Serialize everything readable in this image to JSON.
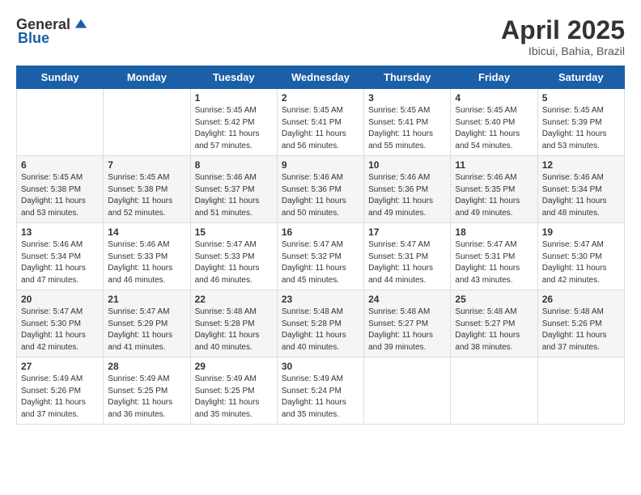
{
  "header": {
    "logo_general": "General",
    "logo_blue": "Blue",
    "month_title": "April 2025",
    "location": "Ibicui, Bahia, Brazil"
  },
  "days_of_week": [
    "Sunday",
    "Monday",
    "Tuesday",
    "Wednesday",
    "Thursday",
    "Friday",
    "Saturday"
  ],
  "weeks": [
    [
      {
        "day": "",
        "sunrise": "",
        "sunset": "",
        "daylight": ""
      },
      {
        "day": "",
        "sunrise": "",
        "sunset": "",
        "daylight": ""
      },
      {
        "day": "1",
        "sunrise": "Sunrise: 5:45 AM",
        "sunset": "Sunset: 5:42 PM",
        "daylight": "Daylight: 11 hours and 57 minutes."
      },
      {
        "day": "2",
        "sunrise": "Sunrise: 5:45 AM",
        "sunset": "Sunset: 5:41 PM",
        "daylight": "Daylight: 11 hours and 56 minutes."
      },
      {
        "day": "3",
        "sunrise": "Sunrise: 5:45 AM",
        "sunset": "Sunset: 5:41 PM",
        "daylight": "Daylight: 11 hours and 55 minutes."
      },
      {
        "day": "4",
        "sunrise": "Sunrise: 5:45 AM",
        "sunset": "Sunset: 5:40 PM",
        "daylight": "Daylight: 11 hours and 54 minutes."
      },
      {
        "day": "5",
        "sunrise": "Sunrise: 5:45 AM",
        "sunset": "Sunset: 5:39 PM",
        "daylight": "Daylight: 11 hours and 53 minutes."
      }
    ],
    [
      {
        "day": "6",
        "sunrise": "Sunrise: 5:45 AM",
        "sunset": "Sunset: 5:38 PM",
        "daylight": "Daylight: 11 hours and 53 minutes."
      },
      {
        "day": "7",
        "sunrise": "Sunrise: 5:45 AM",
        "sunset": "Sunset: 5:38 PM",
        "daylight": "Daylight: 11 hours and 52 minutes."
      },
      {
        "day": "8",
        "sunrise": "Sunrise: 5:46 AM",
        "sunset": "Sunset: 5:37 PM",
        "daylight": "Daylight: 11 hours and 51 minutes."
      },
      {
        "day": "9",
        "sunrise": "Sunrise: 5:46 AM",
        "sunset": "Sunset: 5:36 PM",
        "daylight": "Daylight: 11 hours and 50 minutes."
      },
      {
        "day": "10",
        "sunrise": "Sunrise: 5:46 AM",
        "sunset": "Sunset: 5:36 PM",
        "daylight": "Daylight: 11 hours and 49 minutes."
      },
      {
        "day": "11",
        "sunrise": "Sunrise: 5:46 AM",
        "sunset": "Sunset: 5:35 PM",
        "daylight": "Daylight: 11 hours and 49 minutes."
      },
      {
        "day": "12",
        "sunrise": "Sunrise: 5:46 AM",
        "sunset": "Sunset: 5:34 PM",
        "daylight": "Daylight: 11 hours and 48 minutes."
      }
    ],
    [
      {
        "day": "13",
        "sunrise": "Sunrise: 5:46 AM",
        "sunset": "Sunset: 5:34 PM",
        "daylight": "Daylight: 11 hours and 47 minutes."
      },
      {
        "day": "14",
        "sunrise": "Sunrise: 5:46 AM",
        "sunset": "Sunset: 5:33 PM",
        "daylight": "Daylight: 11 hours and 46 minutes."
      },
      {
        "day": "15",
        "sunrise": "Sunrise: 5:47 AM",
        "sunset": "Sunset: 5:33 PM",
        "daylight": "Daylight: 11 hours and 46 minutes."
      },
      {
        "day": "16",
        "sunrise": "Sunrise: 5:47 AM",
        "sunset": "Sunset: 5:32 PM",
        "daylight": "Daylight: 11 hours and 45 minutes."
      },
      {
        "day": "17",
        "sunrise": "Sunrise: 5:47 AM",
        "sunset": "Sunset: 5:31 PM",
        "daylight": "Daylight: 11 hours and 44 minutes."
      },
      {
        "day": "18",
        "sunrise": "Sunrise: 5:47 AM",
        "sunset": "Sunset: 5:31 PM",
        "daylight": "Daylight: 11 hours and 43 minutes."
      },
      {
        "day": "19",
        "sunrise": "Sunrise: 5:47 AM",
        "sunset": "Sunset: 5:30 PM",
        "daylight": "Daylight: 11 hours and 42 minutes."
      }
    ],
    [
      {
        "day": "20",
        "sunrise": "Sunrise: 5:47 AM",
        "sunset": "Sunset: 5:30 PM",
        "daylight": "Daylight: 11 hours and 42 minutes."
      },
      {
        "day": "21",
        "sunrise": "Sunrise: 5:47 AM",
        "sunset": "Sunset: 5:29 PM",
        "daylight": "Daylight: 11 hours and 41 minutes."
      },
      {
        "day": "22",
        "sunrise": "Sunrise: 5:48 AM",
        "sunset": "Sunset: 5:28 PM",
        "daylight": "Daylight: 11 hours and 40 minutes."
      },
      {
        "day": "23",
        "sunrise": "Sunrise: 5:48 AM",
        "sunset": "Sunset: 5:28 PM",
        "daylight": "Daylight: 11 hours and 40 minutes."
      },
      {
        "day": "24",
        "sunrise": "Sunrise: 5:48 AM",
        "sunset": "Sunset: 5:27 PM",
        "daylight": "Daylight: 11 hours and 39 minutes."
      },
      {
        "day": "25",
        "sunrise": "Sunrise: 5:48 AM",
        "sunset": "Sunset: 5:27 PM",
        "daylight": "Daylight: 11 hours and 38 minutes."
      },
      {
        "day": "26",
        "sunrise": "Sunrise: 5:48 AM",
        "sunset": "Sunset: 5:26 PM",
        "daylight": "Daylight: 11 hours and 37 minutes."
      }
    ],
    [
      {
        "day": "27",
        "sunrise": "Sunrise: 5:49 AM",
        "sunset": "Sunset: 5:26 PM",
        "daylight": "Daylight: 11 hours and 37 minutes."
      },
      {
        "day": "28",
        "sunrise": "Sunrise: 5:49 AM",
        "sunset": "Sunset: 5:25 PM",
        "daylight": "Daylight: 11 hours and 36 minutes."
      },
      {
        "day": "29",
        "sunrise": "Sunrise: 5:49 AM",
        "sunset": "Sunset: 5:25 PM",
        "daylight": "Daylight: 11 hours and 35 minutes."
      },
      {
        "day": "30",
        "sunrise": "Sunrise: 5:49 AM",
        "sunset": "Sunset: 5:24 PM",
        "daylight": "Daylight: 11 hours and 35 minutes."
      },
      {
        "day": "",
        "sunrise": "",
        "sunset": "",
        "daylight": ""
      },
      {
        "day": "",
        "sunrise": "",
        "sunset": "",
        "daylight": ""
      },
      {
        "day": "",
        "sunrise": "",
        "sunset": "",
        "daylight": ""
      }
    ]
  ]
}
